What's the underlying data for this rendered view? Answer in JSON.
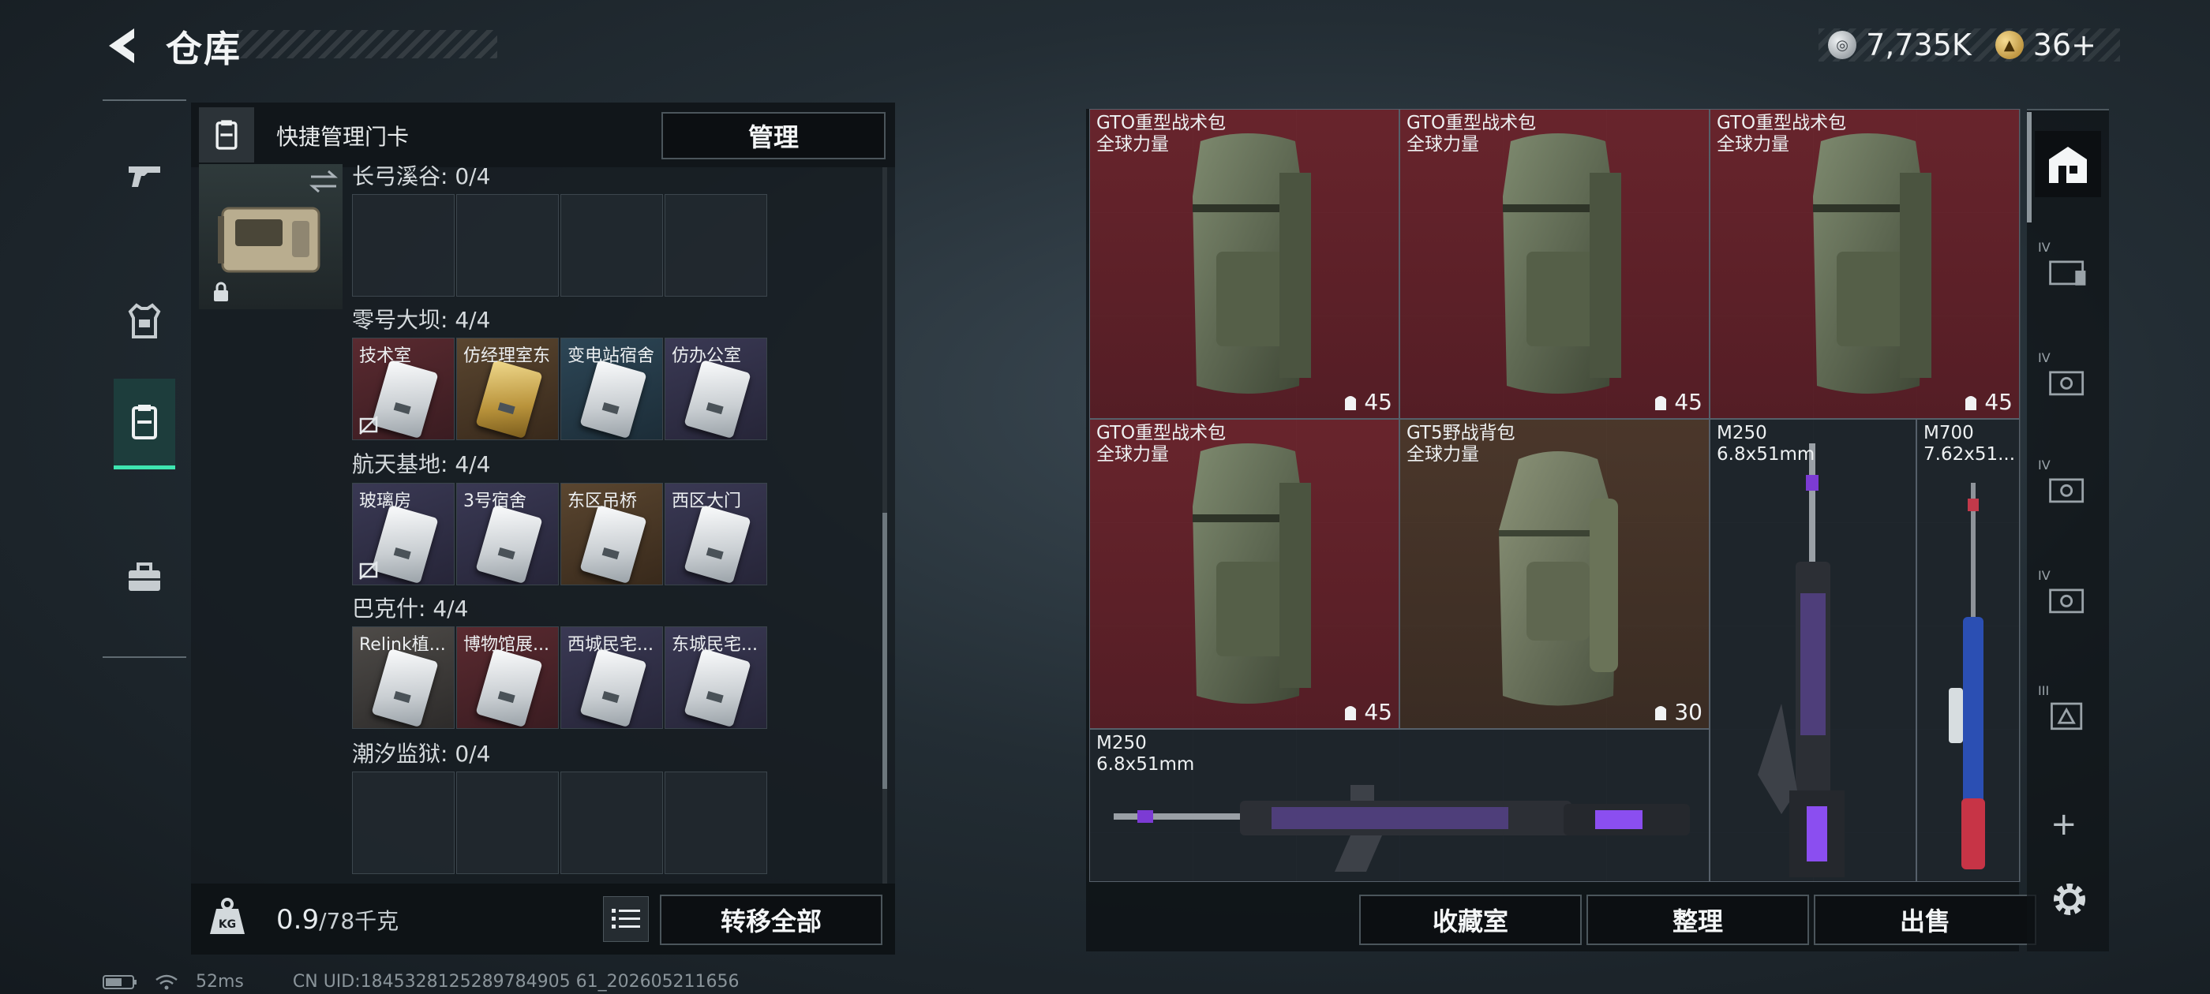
{
  "header": {
    "title": "仓库",
    "currency": [
      {
        "icon": "silver-coin-icon",
        "value": "7,735K"
      },
      {
        "icon": "gold-coin-icon",
        "value": "36+"
      }
    ]
  },
  "nav": {
    "items": [
      "pistol-icon",
      "armor-icon",
      "card-holder-icon",
      "toolbox-icon"
    ],
    "active_index": 2
  },
  "card_panel": {
    "title": "快捷管理门卡",
    "manage_label": "管理",
    "sections": [
      {
        "label": "长弓溪谷: 0/4",
        "slots": []
      },
      {
        "label": "零号大坝: 4/4",
        "slots": [
          {
            "name": "技术室",
            "locked": true
          },
          {
            "name": "仿经理室东",
            "locked": false
          },
          {
            "name": "变电站宿舍",
            "locked": false
          },
          {
            "name": "仿办公室",
            "locked": false
          }
        ]
      },
      {
        "label": "航天基地: 4/4",
        "slots": [
          {
            "name": "玻璃房",
            "locked": true
          },
          {
            "name": "3号宿舍",
            "locked": false
          },
          {
            "name": "东区吊桥",
            "locked": false
          },
          {
            "name": "西区大门",
            "locked": false
          }
        ]
      },
      {
        "label": "巴克什: 4/4",
        "slots": [
          {
            "name": "Relink植...",
            "locked": false
          },
          {
            "name": "博物馆展...",
            "locked": false
          },
          {
            "name": "西城民宅...",
            "locked": false
          },
          {
            "name": "东城民宅...",
            "locked": false
          }
        ]
      },
      {
        "label": "潮汐监狱: 0/4",
        "slots": []
      }
    ],
    "weight": "0.9",
    "weight_max": "/78千克",
    "transfer_all_label": "转移全部"
  },
  "stash": {
    "items": [
      {
        "name": "GTO重型战术包",
        "sub": "全球力量",
        "capacity": "45"
      },
      {
        "name": "GTO重型战术包",
        "sub": "全球力量",
        "capacity": "45"
      },
      {
        "name": "GTO重型战术包",
        "sub": "全球力量",
        "capacity": "45"
      },
      {
        "name": "GTO重型战术包",
        "sub": "全球力量",
        "capacity": "45"
      },
      {
        "name": "GT5野战背包",
        "sub": "全球力量",
        "capacity": "30"
      },
      {
        "name": "M250",
        "sub": "6.8x51mm"
      },
      {
        "name": "M700",
        "sub": "7.62x51..."
      },
      {
        "name": "M250",
        "sub": "6.8x51mm"
      }
    ],
    "buttons": {
      "collection": "收藏室",
      "sort": "整理",
      "sell": "出售"
    }
  },
  "sidebar": {
    "tiers": [
      "IV",
      "IV",
      "IV",
      "IV",
      "III"
    ],
    "add_label": "+"
  },
  "status_bar": {
    "ping": "52ms",
    "uid": "CN UID:1845328125289784905 61_202605211656"
  },
  "colors": {
    "accent": "#3ee5b0",
    "rarity_red": "#6e242c",
    "rarity_brown": "#4e382a"
  }
}
